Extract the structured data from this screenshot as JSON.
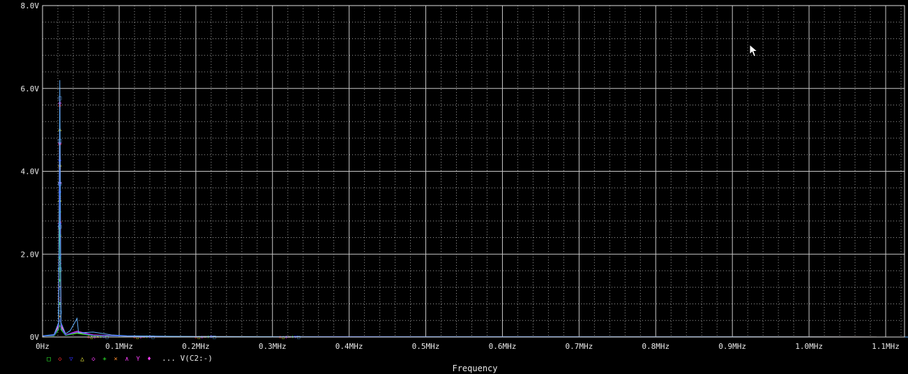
{
  "chart_data": {
    "type": "line",
    "title": "",
    "xlabel": "Frequency",
    "ylabel": "",
    "xlim": [
      0,
      1.1
    ],
    "ylim": [
      0,
      8
    ],
    "grid": true,
    "x_ticks": [
      {
        "v": 0.0,
        "label": "0Hz"
      },
      {
        "v": 0.1,
        "label": "0.1MHz"
      },
      {
        "v": 0.2,
        "label": "0.2MHz"
      },
      {
        "v": 0.3,
        "label": "0.3MHz"
      },
      {
        "v": 0.4,
        "label": "0.4MHz"
      },
      {
        "v": 0.5,
        "label": "0.5MHz"
      },
      {
        "v": 0.6,
        "label": "0.6MHz"
      },
      {
        "v": 0.7,
        "label": "0.7MHz"
      },
      {
        "v": 0.8,
        "label": "0.8MHz"
      },
      {
        "v": 0.9,
        "label": "0.9MHz"
      },
      {
        "v": 1.0,
        "label": "1.0MHz"
      },
      {
        "v": 1.1,
        "label": "1.1MHz"
      }
    ],
    "y_ticks": [
      {
        "v": 0,
        "label": "0V"
      },
      {
        "v": 2,
        "label": "2.0V"
      },
      {
        "v": 4,
        "label": "4.0V"
      },
      {
        "v": 6,
        "label": "6.0V"
      },
      {
        "v": 8,
        "label": "8.0V"
      }
    ],
    "legend": {
      "position": "bottom-left",
      "markers": [
        "□",
        "◇",
        "▽",
        "△",
        "◇",
        "+",
        "×",
        "∧",
        "Y",
        "♦"
      ],
      "text": "... V(C2:-)"
    },
    "series": [
      {
        "color": "#ff3030",
        "marker": "◇",
        "peak": 5.6,
        "points": [
          [
            0,
            0.02
          ],
          [
            0.015,
            0.05
          ],
          [
            0.021,
            0.3
          ],
          [
            0.0225,
            5.6
          ],
          [
            0.024,
            0.3
          ],
          [
            0.03,
            0.06
          ],
          [
            0.045,
            0.12
          ],
          [
            0.066,
            0.05
          ],
          [
            0.11,
            0.02
          ],
          [
            0.2,
            0.01
          ],
          [
            1.2,
            0.0
          ]
        ]
      },
      {
        "color": "#ffff40",
        "marker": "△",
        "peak": 5.1,
        "points": [
          [
            0,
            0.02
          ],
          [
            0.015,
            0.04
          ],
          [
            0.021,
            0.25
          ],
          [
            0.0225,
            5.1
          ],
          [
            0.024,
            0.25
          ],
          [
            0.03,
            0.05
          ],
          [
            0.045,
            0.1
          ],
          [
            0.066,
            0.04
          ],
          [
            0.11,
            0.02
          ],
          [
            0.2,
            0.01
          ],
          [
            1.2,
            0.0
          ]
        ]
      },
      {
        "color": "#ff40ff",
        "marker": "◇",
        "peak": 5.8,
        "points": [
          [
            0,
            0.02
          ],
          [
            0.015,
            0.05
          ],
          [
            0.021,
            0.3
          ],
          [
            0.0225,
            5.8
          ],
          [
            0.024,
            0.3
          ],
          [
            0.03,
            0.05
          ],
          [
            0.045,
            0.14
          ],
          [
            0.066,
            0.05
          ],
          [
            0.11,
            0.02
          ],
          [
            0.2,
            0.01
          ],
          [
            1.2,
            0.0
          ]
        ]
      },
      {
        "color": "#ff9030",
        "marker": "×",
        "peak": 4.3,
        "points": [
          [
            0,
            0.02
          ],
          [
            0.015,
            0.04
          ],
          [
            0.021,
            0.2
          ],
          [
            0.0225,
            4.3
          ],
          [
            0.024,
            0.2
          ],
          [
            0.03,
            0.04
          ],
          [
            0.045,
            0.1
          ],
          [
            0.066,
            0.04
          ],
          [
            0.11,
            0.02
          ],
          [
            0.2,
            0.01
          ],
          [
            1.2,
            0.0
          ]
        ]
      },
      {
        "color": "#30ff30",
        "marker": "+",
        "peak": 3.3,
        "points": [
          [
            0,
            0.02
          ],
          [
            0.015,
            0.03
          ],
          [
            0.021,
            0.18
          ],
          [
            0.0225,
            3.3
          ],
          [
            0.024,
            0.18
          ],
          [
            0.03,
            0.04
          ],
          [
            0.045,
            0.09
          ],
          [
            0.066,
            0.03
          ],
          [
            0.11,
            0.02
          ],
          [
            0.2,
            0.01
          ],
          [
            1.2,
            0.0
          ]
        ]
      },
      {
        "color": "#3030ff",
        "marker": "▽",
        "peak": 4.6,
        "points": [
          [
            0,
            0.02
          ],
          [
            0.015,
            0.04
          ],
          [
            0.021,
            0.22
          ],
          [
            0.0225,
            4.6
          ],
          [
            0.024,
            0.22
          ],
          [
            0.03,
            0.05
          ],
          [
            0.045,
            0.12
          ],
          [
            0.066,
            0.04
          ],
          [
            0.11,
            0.02
          ],
          [
            0.2,
            0.01
          ],
          [
            1.2,
            0.0
          ]
        ]
      },
      {
        "color": "#60b0ff",
        "marker": "□",
        "peak": 6.2,
        "points": [
          [
            0,
            0.03
          ],
          [
            0.015,
            0.06
          ],
          [
            0.021,
            0.35
          ],
          [
            0.0225,
            6.2
          ],
          [
            0.024,
            0.35
          ],
          [
            0.03,
            0.08
          ],
          [
            0.036,
            0.15
          ],
          [
            0.045,
            0.45
          ],
          [
            0.047,
            0.1
          ],
          [
            0.066,
            0.12
          ],
          [
            0.09,
            0.05
          ],
          [
            0.11,
            0.03
          ],
          [
            0.2,
            0.01
          ],
          [
            0.39,
            0.005
          ],
          [
            1.2,
            0.0
          ]
        ]
      }
    ]
  }
}
